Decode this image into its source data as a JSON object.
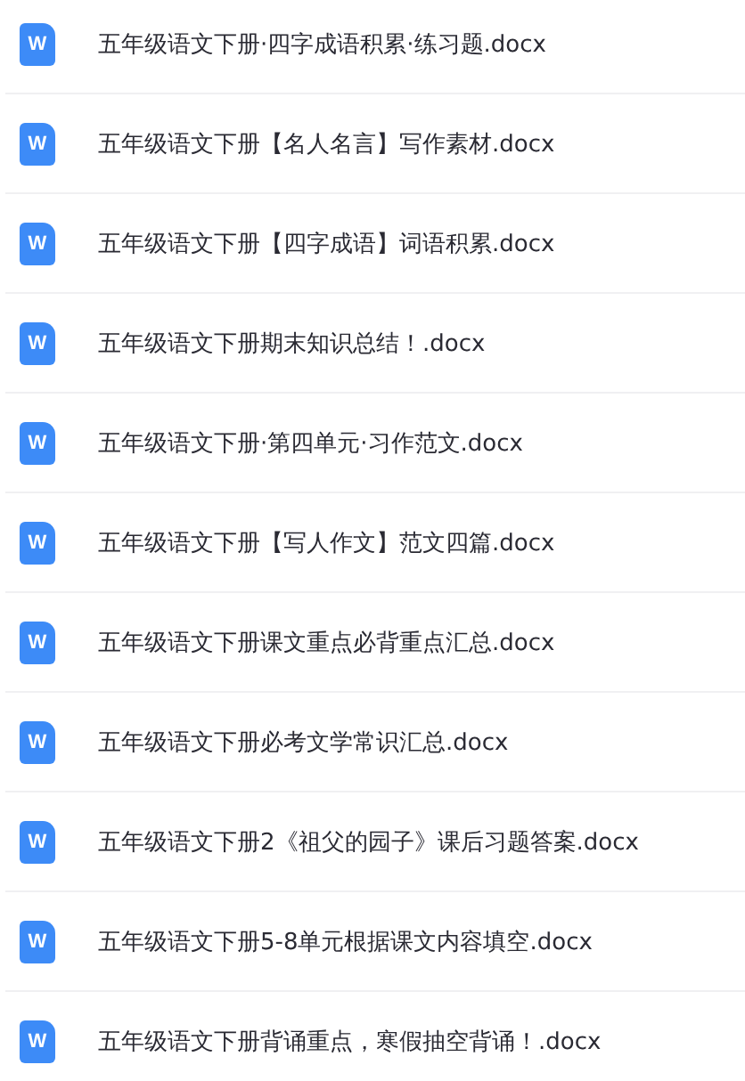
{
  "files": [
    {
      "icon_letter": "W",
      "name": "五年级语文下册·四字成语积累·练习题.docx"
    },
    {
      "icon_letter": "W",
      "name": "五年级语文下册【名人名言】写作素材.docx"
    },
    {
      "icon_letter": "W",
      "name": "五年级语文下册【四字成语】词语积累.docx"
    },
    {
      "icon_letter": "W",
      "name": "五年级语文下册期末知识总结！.docx"
    },
    {
      "icon_letter": "W",
      "name": "五年级语文下册·第四单元·习作范文.docx"
    },
    {
      "icon_letter": "W",
      "name": "五年级语文下册【写人作文】范文四篇.docx"
    },
    {
      "icon_letter": "W",
      "name": "五年级语文下册课文重点必背重点汇总.docx"
    },
    {
      "icon_letter": "W",
      "name": "五年级语文下册必考文学常识汇总.docx"
    },
    {
      "icon_letter": "W",
      "name": "五年级语文下册2《祖父的园子》课后习题答案.docx"
    },
    {
      "icon_letter": "W",
      "name": "五年级语文下册5-8单元根据课文内容填空.docx"
    },
    {
      "icon_letter": "W",
      "name": "五年级语文下册背诵重点，寒假抽空背诵！.docx"
    }
  ]
}
